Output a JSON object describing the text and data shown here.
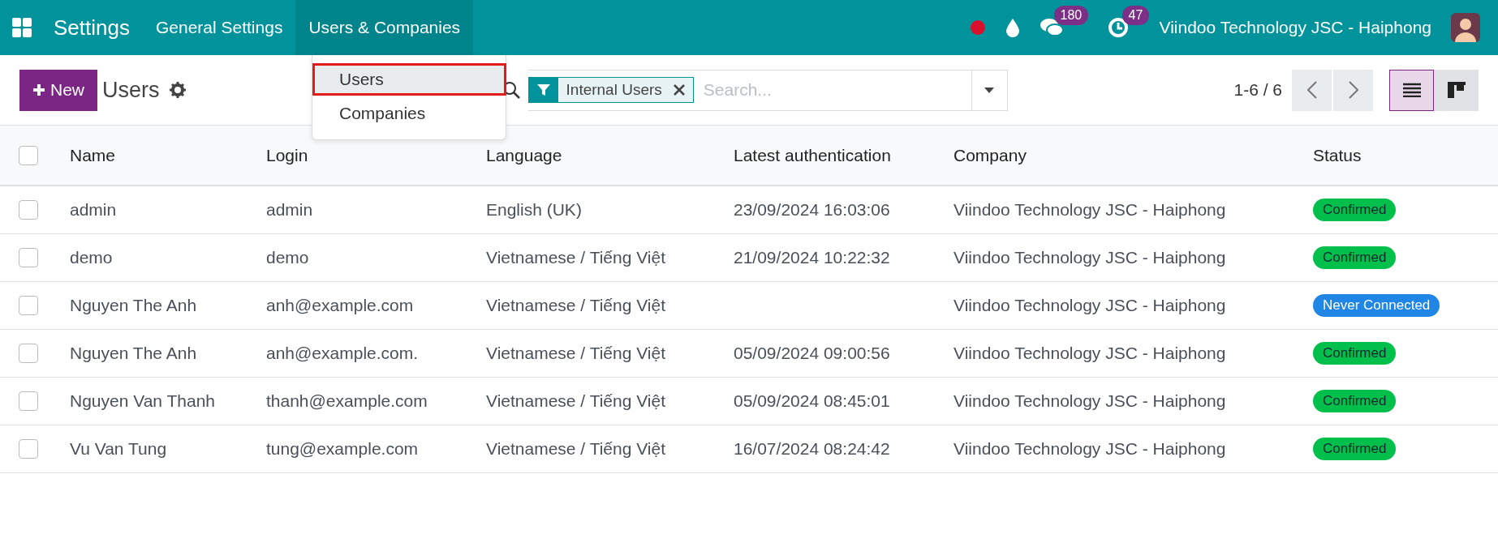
{
  "navbar": {
    "app_title": "Settings",
    "menus": [
      {
        "label": "General Settings",
        "selected": false
      },
      {
        "label": "Users & Companies",
        "selected": true
      }
    ],
    "messages_count": "180",
    "activities_count": "47",
    "company": "Viindoo Technology JSC - Haiphong"
  },
  "dropdown": {
    "items": [
      {
        "label": "Users",
        "highlighted": true
      },
      {
        "label": "Companies",
        "highlighted": false
      }
    ]
  },
  "control_panel": {
    "new_button": "New",
    "breadcrumb": "Users",
    "facet": "Internal Users",
    "search": {
      "placeholder": "Search..."
    },
    "pager": "1-6 / 6",
    "views": [
      {
        "kind": "list",
        "selected": true
      },
      {
        "kind": "kanban",
        "selected": false
      }
    ]
  },
  "table": {
    "columns": [
      "Name",
      "Login",
      "Language",
      "Latest authentication",
      "Company",
      "Status"
    ],
    "all_checked": false,
    "rows": [
      {
        "checked": false,
        "name": "admin",
        "login": "admin",
        "language": "English (UK)",
        "latest": "23/09/2024 16:03:06",
        "company": "Viindoo Technology JSC - Haiphong",
        "status": {
          "kind": "confirmed",
          "label": "Confirmed"
        }
      },
      {
        "checked": false,
        "name": "demo",
        "login": "demo",
        "language": "Vietnamese / Tiếng Việt",
        "latest": "21/09/2024 10:22:32",
        "company": "Viindoo Technology JSC - Haiphong",
        "status": {
          "kind": "confirmed",
          "label": "Confirmed"
        }
      },
      {
        "checked": false,
        "name": "Nguyen The Anh",
        "login": "anh@example.com",
        "language": "Vietnamese / Tiếng Việt",
        "company": "Viindoo Technology JSC - Haiphong",
        "status": {
          "kind": "never",
          "label": "Never Connected"
        }
      },
      {
        "checked": false,
        "name": "Nguyen The Anh",
        "login": "anh@example.com.",
        "language": "Vietnamese / Tiếng Việt",
        "latest": "05/09/2024 09:00:56",
        "company": "Viindoo Technology JSC - Haiphong",
        "status": {
          "kind": "confirmed",
          "label": "Confirmed"
        }
      },
      {
        "checked": false,
        "name": "Nguyen Van Thanh",
        "login": "thanh@example.com",
        "language": "Vietnamese / Tiếng Việt",
        "latest": "05/09/2024 08:45:01",
        "company": "Viindoo Technology JSC - Haiphong",
        "status": {
          "kind": "confirmed",
          "label": "Confirmed"
        }
      },
      {
        "checked": false,
        "name": "Vu Van Tung",
        "login": "tung@example.com",
        "language": "Vietnamese / Tiếng Việt",
        "latest": "16/07/2024 08:24:42",
        "company": "Viindoo Technology JSC - Haiphong",
        "status": {
          "kind": "confirmed",
          "label": "Confirmed"
        }
      }
    ]
  }
}
